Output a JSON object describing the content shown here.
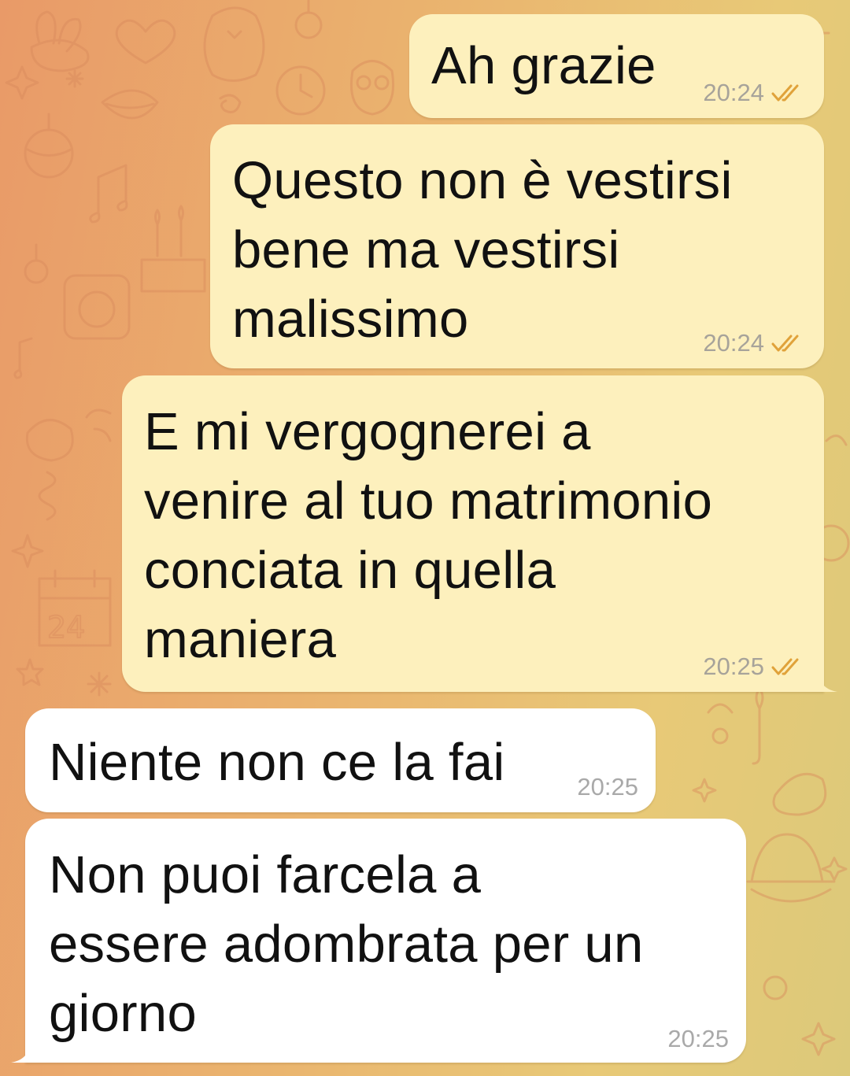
{
  "colors": {
    "outgoing_bubble": "#fdf0bd",
    "incoming_bubble": "#ffffff",
    "read_check": "#e0a23a",
    "time_text": "#a7a39a"
  },
  "messages": [
    {
      "id": "m1",
      "direction": "outgoing",
      "text": "Ah grazie",
      "time": "20:24",
      "status": "read",
      "status_icon": "double-check-icon"
    },
    {
      "id": "m2",
      "direction": "outgoing",
      "text": "Questo non è vestirsi\nbene ma vestirsi\nmalissimo",
      "time": "20:24",
      "status": "read",
      "status_icon": "double-check-icon"
    },
    {
      "id": "m3",
      "direction": "outgoing",
      "text": "E mi vergognerei a\nvenire al tuo matrimonio\nconciata in quella\nmaniera",
      "time": "20:25",
      "status": "read",
      "status_icon": "double-check-icon"
    },
    {
      "id": "m4",
      "direction": "incoming",
      "text": "Niente non ce la fai",
      "time": "20:25"
    },
    {
      "id": "m5",
      "direction": "incoming",
      "text": "Non puoi farcela a\nessere adombrata per un\ngiorno",
      "time": "20:25"
    }
  ]
}
